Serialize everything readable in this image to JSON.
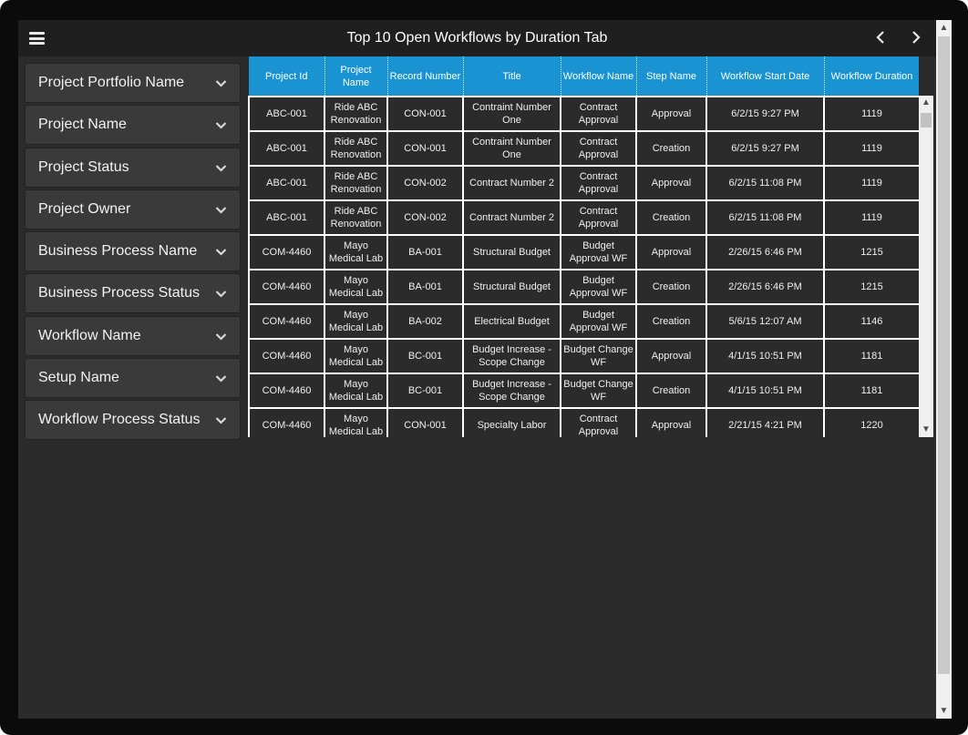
{
  "header": {
    "title": "Top 10 Open Workflows by Duration Tab",
    "menu_icon": "hamburger-menu-icon",
    "prev_icon": "chevron-left-icon",
    "next_icon": "chevron-right-icon"
  },
  "filters": [
    {
      "label": "Project Portfolio Name"
    },
    {
      "label": "Project Name"
    },
    {
      "label": "Project Status"
    },
    {
      "label": "Project Owner"
    },
    {
      "label": "Business Process Name"
    },
    {
      "label": "Business Process Status"
    },
    {
      "label": "Workflow Name"
    },
    {
      "label": "Setup Name"
    },
    {
      "label": "Workflow Process Status"
    }
  ],
  "table": {
    "columns": [
      "Project Id",
      "Project Name",
      "Record Number",
      "Title",
      "Workflow Name",
      "Step Name",
      "Workflow Start Date",
      "Workflow Duration"
    ],
    "rows": [
      [
        "ABC-001",
        "Ride ABC Renovation",
        "CON-001",
        "Contraint Number One",
        "Contract Approval",
        "Approval",
        "6/2/15 9:27 PM",
        "1119"
      ],
      [
        "ABC-001",
        "Ride ABC Renovation",
        "CON-001",
        "Contraint Number One",
        "Contract Approval",
        "Creation",
        "6/2/15 9:27 PM",
        "1119"
      ],
      [
        "ABC-001",
        "Ride ABC Renovation",
        "CON-002",
        "Contract Number 2",
        "Contract Approval",
        "Approval",
        "6/2/15 11:08 PM",
        "1119"
      ],
      [
        "ABC-001",
        "Ride ABC Renovation",
        "CON-002",
        "Contract Number 2",
        "Contract Approval",
        "Creation",
        "6/2/15 11:08 PM",
        "1119"
      ],
      [
        "COM-4460",
        "Mayo Medical Lab",
        "BA-001",
        "Structural Budget",
        "Budget Approval WF",
        "Approval",
        "2/26/15 6:46 PM",
        "1215"
      ],
      [
        "COM-4460",
        "Mayo Medical Lab",
        "BA-001",
        "Structural Budget",
        "Budget Approval WF",
        "Creation",
        "2/26/15 6:46 PM",
        "1215"
      ],
      [
        "COM-4460",
        "Mayo Medical Lab",
        "BA-002",
        "Electrical Budget",
        "Budget Approval WF",
        "Creation",
        "5/6/15 12:07 AM",
        "1146"
      ],
      [
        "COM-4460",
        "Mayo Medical Lab",
        "BC-001",
        "Budget Increase - Scope Change",
        "Budget Change WF",
        "Approval",
        "4/1/15 10:51 PM",
        "1181"
      ],
      [
        "COM-4460",
        "Mayo Medical Lab",
        "BC-001",
        "Budget Increase - Scope Change",
        "Budget Change WF",
        "Creation",
        "4/1/15 10:51 PM",
        "1181"
      ],
      [
        "COM-4460",
        "Mayo Medical Lab",
        "CON-001",
        "Specialty Labor",
        "Contract Approval",
        "Approval",
        "2/21/15 4:21 PM",
        "1220"
      ]
    ]
  },
  "colors": {
    "header_blue": "#1a93d3",
    "panel_dark": "#2b2b2b",
    "titlebar": "#1f1f1f"
  }
}
